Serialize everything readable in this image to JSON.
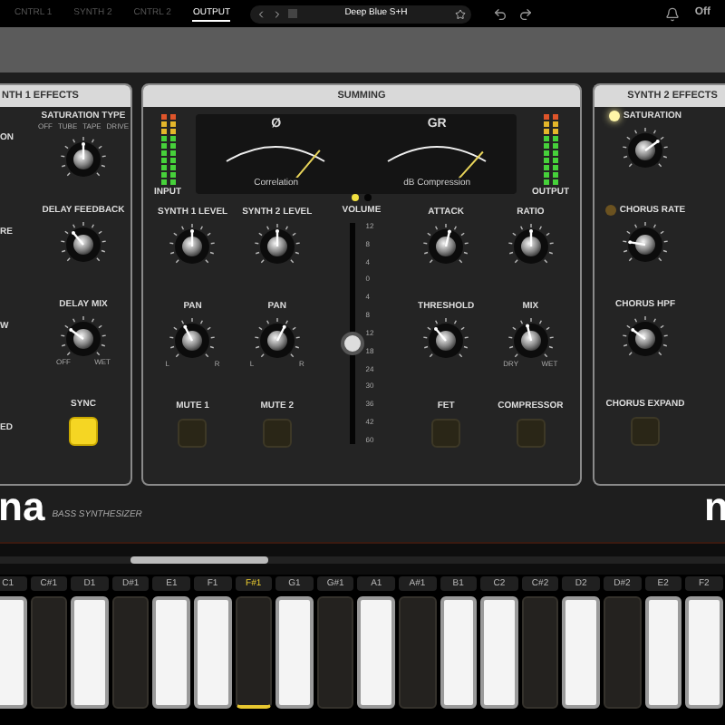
{
  "tabs": [
    {
      "label": "CNTRL 1",
      "selected": false
    },
    {
      "label": "SYNTH 2",
      "selected": false
    },
    {
      "label": "CNTRL 2",
      "selected": false
    },
    {
      "label": "OUTPUT",
      "selected": true
    }
  ],
  "preset": {
    "name": "Deep Blue S+H",
    "favorite": false
  },
  "power_label": "Off",
  "left_panel": {
    "title": "NTH 1 EFFECTS",
    "cut_labels": [
      "ON",
      "RE",
      "W",
      "ED"
    ],
    "controls": [
      {
        "kind": "knob",
        "label": "SATURATION TYPE",
        "options": [
          "OFF",
          "TUBE",
          "TAPE",
          "DRIVE"
        ],
        "level": 0.5
      },
      {
        "kind": "knob",
        "label": "DELAY FEEDBACK",
        "level": 0.35
      },
      {
        "kind": "knob",
        "label": "DELAY MIX",
        "min_label": "OFF",
        "max_label": "WET",
        "level": 0.3
      },
      {
        "kind": "button",
        "label": "SYNC",
        "on": true
      }
    ]
  },
  "summing": {
    "title": "SUMMING",
    "input_label": "INPUT",
    "output_label": "OUTPUT",
    "meters": [
      {
        "symbol": "Ø",
        "caption": "Correlation",
        "level": 0.9
      },
      {
        "symbol": "GR",
        "caption": "dB Compression",
        "level": 0.92
      }
    ],
    "meter_pages": [
      {
        "selected": true
      },
      {
        "selected": false
      }
    ],
    "columns": [
      [
        {
          "kind": "knob",
          "label": "SYNTH 1 LEVEL",
          "level": 0.5
        },
        {
          "kind": "knob",
          "label": "PAN",
          "min_label": "L",
          "max_label": "R",
          "level": 0.4
        },
        {
          "kind": "button",
          "label": "MUTE 1",
          "on": false
        }
      ],
      [
        {
          "kind": "knob",
          "label": "SYNTH 2 LEVEL",
          "level": 0.5
        },
        {
          "kind": "knob",
          "label": "PAN",
          "min_label": "L",
          "max_label": "R",
          "level": 0.6
        },
        {
          "kind": "button",
          "label": "MUTE 2",
          "on": false
        }
      ],
      [
        {
          "kind": "fader",
          "label": "VOLUME",
          "level": 0.45,
          "scale": [
            "12",
            "8",
            "4",
            "0",
            "4",
            "8",
            "12",
            "18",
            "24",
            "30",
            "36",
            "42",
            "60"
          ]
        }
      ],
      [
        {
          "kind": "knob",
          "label": "ATTACK",
          "level": 0.55
        },
        {
          "kind": "knob",
          "label": "THRESHOLD",
          "level": 0.35
        },
        {
          "kind": "button",
          "label": "FET",
          "on": false
        }
      ],
      [
        {
          "kind": "knob",
          "label": "RATIO",
          "level": 0.5
        },
        {
          "kind": "knob",
          "label": "MIX",
          "min_label": "DRY",
          "max_label": "WET",
          "level": 0.45
        },
        {
          "kind": "button",
          "label": "COMPRESSOR",
          "on": false
        }
      ]
    ]
  },
  "right_panel": {
    "title": "SYNTH 2 EFFECTS",
    "controls": [
      {
        "kind": "knob",
        "label": "SATURATION",
        "led": true,
        "level": 0.7
      },
      {
        "kind": "knob",
        "label": "CHORUS RATE",
        "led": false,
        "level": 0.2
      },
      {
        "kind": "knob",
        "label": "CHORUS HPF",
        "level": 0.3
      },
      {
        "kind": "button",
        "label": "CHORUS EXPAND",
        "on": false
      }
    ]
  },
  "brand": {
    "name": "na",
    "subtitle": "BASS SYNTHESIZER",
    "mark": "n"
  },
  "keys": [
    {
      "label": "C1",
      "kind": "white",
      "selected": false
    },
    {
      "label": "C#1",
      "kind": "black",
      "selected": false
    },
    {
      "label": "D1",
      "kind": "white",
      "selected": false
    },
    {
      "label": "D#1",
      "kind": "black",
      "selected": false
    },
    {
      "label": "E1",
      "kind": "white",
      "selected": false
    },
    {
      "label": "F1",
      "kind": "white",
      "selected": false
    },
    {
      "label": "F#1",
      "kind": "black",
      "selected": true
    },
    {
      "label": "G1",
      "kind": "white",
      "selected": false
    },
    {
      "label": "G#1",
      "kind": "black",
      "selected": false
    },
    {
      "label": "A1",
      "kind": "white",
      "selected": false
    },
    {
      "label": "A#1",
      "kind": "black",
      "selected": false
    },
    {
      "label": "B1",
      "kind": "white",
      "selected": false
    },
    {
      "label": "C2",
      "kind": "white",
      "selected": false
    },
    {
      "label": "C#2",
      "kind": "black",
      "selected": false
    },
    {
      "label": "D2",
      "kind": "white",
      "selected": false
    },
    {
      "label": "D#2",
      "kind": "black",
      "selected": false
    },
    {
      "label": "E2",
      "kind": "white",
      "selected": false
    },
    {
      "label": "F2",
      "kind": "white",
      "selected": false
    }
  ]
}
